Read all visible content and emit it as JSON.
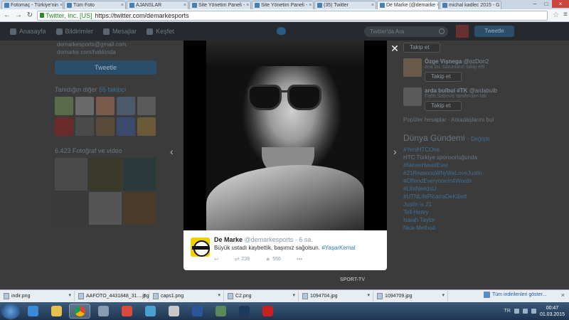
{
  "browser": {
    "tabs": [
      {
        "label": "Fotomaç - Türkiye'nin",
        "active": false
      },
      {
        "label": "Tüm Foto",
        "active": false
      },
      {
        "label": "AJANSLAR",
        "active": false
      },
      {
        "label": "Site Yönetim Paneli -",
        "active": false
      },
      {
        "label": "Site Yönetim Paneli -",
        "active": false
      },
      {
        "label": "(35) Twitter",
        "active": false
      },
      {
        "label": "De Marke (@demarke",
        "active": true
      },
      {
        "label": "michal kadlec 2015 - G",
        "active": false
      }
    ],
    "secure_label": "Twitter, Inc. [US]",
    "url": "https://twitter.com/demarkesports"
  },
  "twitter": {
    "nav": [
      {
        "label": "Anasayfa"
      },
      {
        "label": "Bildirimler"
      },
      {
        "label": "Mesajlar"
      },
      {
        "label": "Keşfet"
      }
    ],
    "search_placeholder": "Twitter'da Ara",
    "tweet_button": "Tweetle",
    "left": {
      "contact_email": "demarkesports@gmail.com",
      "contact_line2": "demarke com/hakkinda",
      "tweet_button": "Tweetle",
      "followers_label": "Tanıdığın diğer",
      "followers_count": "55 takipçi",
      "media_label": "6.423 Fotoğraf ve video"
    },
    "right": {
      "follow_label": "Takip et",
      "suggestions": [
        {
          "name": "Özge Vişnega",
          "handle": "@ozDon2",
          "sub": "ana bu, sorunların takip etti",
          "follow": "Takip et"
        },
        {
          "name": "arda bulbul #TK",
          "handle": "@ardabulb",
          "sub": "Fatih Sabovic tarafından tak",
          "follow": "Takip et"
        }
      ],
      "links": "Popüler hesaplar · Arkadaşlarını bul",
      "trends_title": "Dünya Gündemi",
      "trends_change": "· Değiştir",
      "trends": [
        {
          "label": "#YeniHTCOne",
          "promoted": false
        },
        {
          "label": "HTC Türkiye sponsorluğunda",
          "promoted": true
        },
        {
          "label": "#NeverHaveIEver",
          "promoted": false
        },
        {
          "label": "#21ReasonsWhyWeLoveJustin",
          "promoted": false
        },
        {
          "label": "#OffendEveryoneIn4Words",
          "promoted": false
        },
        {
          "label": "#LifeNeedsU",
          "promoted": false
        },
        {
          "label": "#UTNLifePicarraDeKibelt",
          "promoted": false
        },
        {
          "label": "Justin is 21",
          "promoted": false
        },
        {
          "label": "Tell Henry",
          "promoted": false
        },
        {
          "label": "Isaiah Taylor",
          "promoted": false
        },
        {
          "label": "Nice Method",
          "promoted": false
        }
      ]
    }
  },
  "modal": {
    "author_name": "De Marke",
    "author_handle": "@demarkesports",
    "time": "· 6 sa.",
    "text": "Büyük ustadı kaybettik, başımız sağolsun.",
    "hashtag": "#YaşarKemal",
    "retweets": "239",
    "favorites": "556",
    "more": "•••",
    "credit": "SPORT-TV"
  },
  "downloads": {
    "items": [
      {
        "name": "indir.png"
      },
      {
        "name": "AAFOTO_4431848_31....jpg"
      },
      {
        "name": "caps1.png"
      },
      {
        "name": "C2.png"
      },
      {
        "name": "1094704.jpg"
      },
      {
        "name": "1094709.jpg"
      }
    ],
    "show_all": "Tüm indirilenleri göster..."
  },
  "taskbar": {
    "lang": "TR",
    "time": "00:47",
    "date": "01.03.2015"
  }
}
